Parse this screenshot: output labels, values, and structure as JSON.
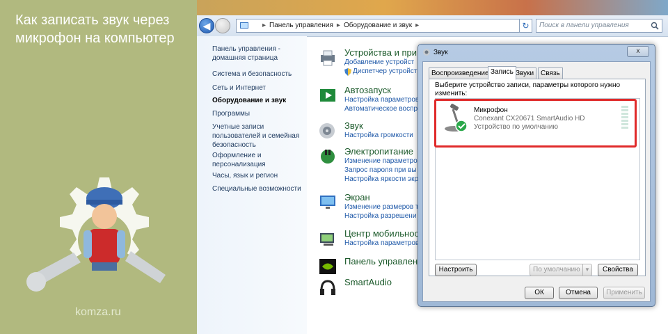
{
  "promo": {
    "title": "Как записать звук через микрофон на компьютер",
    "site": "komza.ru"
  },
  "addressbar": {
    "breadcrumb": [
      "Панель управления",
      "Оборудование и звук"
    ],
    "search_placeholder": "Поиск в панели управления"
  },
  "sidebar": {
    "home": "Панель управления - домашняя страница",
    "items": [
      "Система и безопасность",
      "Сеть и Интернет",
      "Оборудование и звук",
      "Программы",
      "Учетные записи пользователей и семейная безопасность",
      "Оформление и персонализация",
      "Часы, язык и регион",
      "Специальные возможности"
    ]
  },
  "categories": [
    {
      "title": "Устройства и при",
      "links": [
        "Добавление устройст",
        "Диспетчер устройст"
      ]
    },
    {
      "title": "Автозапуск",
      "links": [
        "Настройка параметров",
        "Автоматическое воспр"
      ]
    },
    {
      "title": "Звук",
      "links": [
        "Настройка громкости"
      ]
    },
    {
      "title": "Электропитание",
      "links": [
        "Изменение параметров",
        "Запрос пароля при вы",
        "Настройка яркости экр"
      ]
    },
    {
      "title": "Экран",
      "links": [
        "Изменение размеров т",
        "Настройка разрешени"
      ]
    },
    {
      "title": "Центр мобильнос",
      "links": [
        "Настройка параметров"
      ]
    },
    {
      "title": "Панель управлени",
      "links": []
    },
    {
      "title": "SmartAudio",
      "links": []
    }
  ],
  "dialog": {
    "title": "Звук",
    "close": "x",
    "tabs": [
      "Воспроизведение",
      "Запись",
      "Звуки",
      "Связь"
    ],
    "prompt": "Выберите устройство записи, параметры которого нужно изменить:",
    "device": {
      "name": "Микрофон",
      "driver": "Conexant CX20671 SmartAudio HD",
      "status": "Устройство по умолчанию"
    },
    "configure_button": "Настроить",
    "default_button": "По умолчанию",
    "properties_button": "Свойства",
    "ok_button": "ОК",
    "cancel_button": "Отмена",
    "apply_button": "Применить"
  }
}
